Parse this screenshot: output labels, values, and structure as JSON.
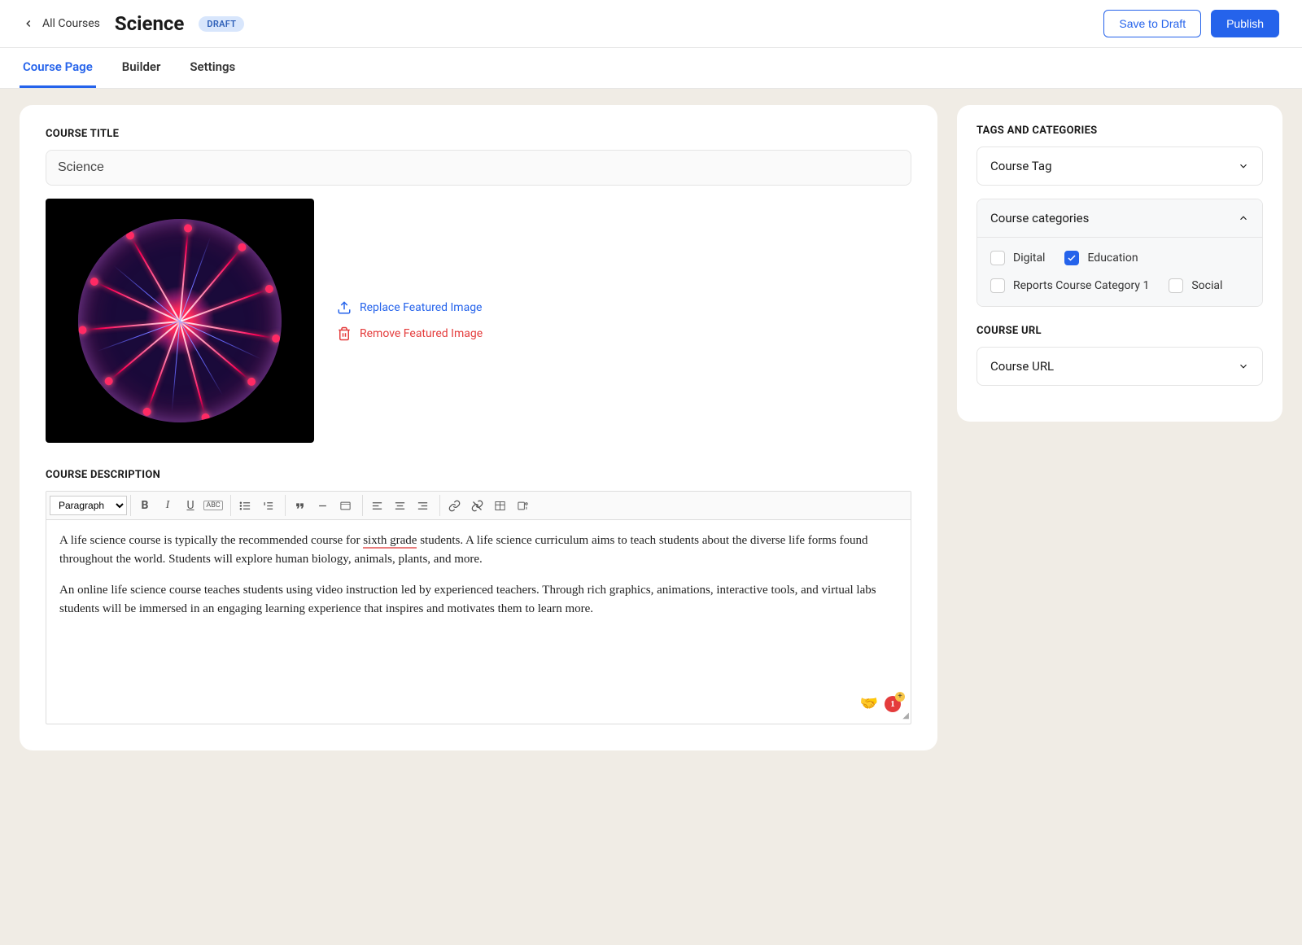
{
  "header": {
    "back_label": "All Courses",
    "title": "Science",
    "draft_badge": "DRAFT",
    "save_draft": "Save to Draft",
    "publish": "Publish"
  },
  "tabs": {
    "course_page": "Course Page",
    "builder": "Builder",
    "settings": "Settings"
  },
  "main": {
    "course_title_label": "COURSE TITLE",
    "course_title_value": "Science",
    "replace_image": "Replace Featured Image",
    "remove_image": "Remove Featured Image",
    "course_desc_label": "COURSE DESCRIPTION",
    "toolbar": {
      "block_select": "Paragraph"
    },
    "desc_p1_a": "A life science course is typically the recommended course for ",
    "desc_p1_spell": "sixth grade",
    "desc_p1_b": " students. A life science curriculum aims to teach students about the diverse life forms found throughout the world. Students will explore human biology, animals, plants, and more.",
    "desc_p2": "An online life science course teaches students using video instruction led by experienced teachers. Through rich graphics, animations, interactive tools, and virtual labs students will be immersed in an engaging learning experience that inspires and motivates them to learn more.",
    "notif_count": "1"
  },
  "side": {
    "tags_label": "TAGS AND CATEGORIES",
    "course_tag": "Course Tag",
    "course_categories": "Course categories",
    "cat_digital": "Digital",
    "cat_education": "Education",
    "cat_reports": "Reports Course Category 1",
    "cat_social": "Social",
    "course_url_label": "COURSE URL",
    "course_url": "Course URL"
  }
}
